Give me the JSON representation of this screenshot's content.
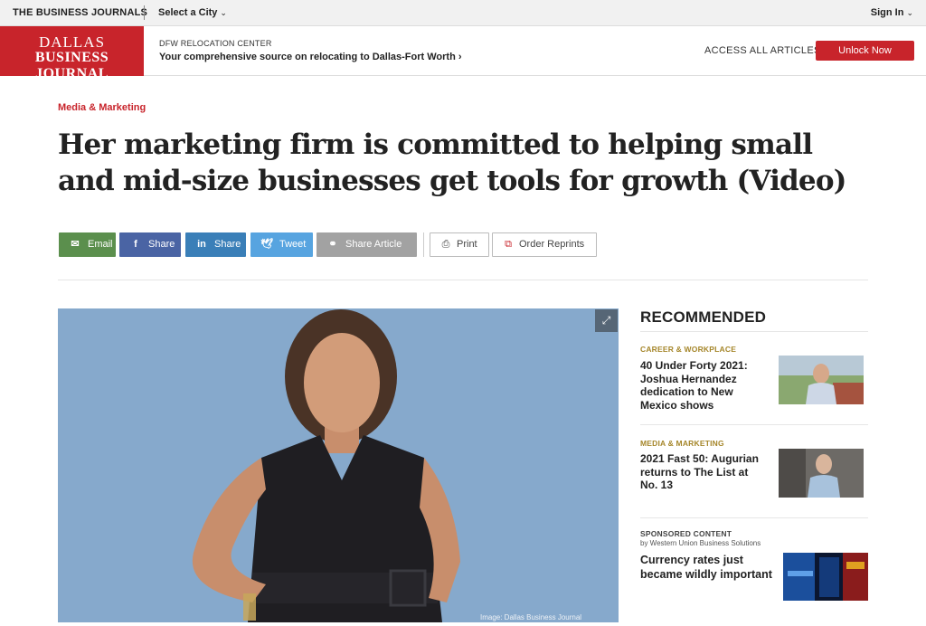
{
  "topbar": {
    "brand": "THE BUSINESS JOURNALS",
    "city_select": "Select a City",
    "sign_in": "Sign In"
  },
  "header": {
    "logo_line1": "DALLAS",
    "logo_line2": "BUSINESS JOURNAL",
    "relocation_label": "DFW RELOCATION CENTER",
    "relocation_text": "Your comprehensive source on relocating to Dallas-Fort Worth",
    "access_label": "ACCESS ALL ARTICLES",
    "unlock_label": "Unlock Now"
  },
  "article": {
    "section": "Media & Marketing",
    "headline": "Her marketing firm is committed to helping small and mid-size businesses get tools for growth (Video)",
    "image_credit": "Image: Dallas Business Journal"
  },
  "share": {
    "email": "Email",
    "facebook": "Share",
    "linkedin": "Share",
    "twitter": "Tweet",
    "share_article": "Share Article",
    "print": "Print",
    "order_reprints": "Order Reprints"
  },
  "recommended": {
    "title": "RECOMMENDED",
    "items": [
      {
        "category": "CAREER & WORKPLACE",
        "title": "40 Under Forty 2021: Joshua Hernandez dedication to New Mexico shows"
      },
      {
        "category": "MEDIA & MARKETING",
        "title": "2021 Fast 50: Augurian returns to The List at No. 13"
      }
    ],
    "sponsored": {
      "label": "SPONSORED CONTENT",
      "by": "by Western Union Business Solutions",
      "title": "Currency rates just became wildly important"
    }
  },
  "colors": {
    "brand_red": "#c8242b",
    "email_green": "#5b8f4d",
    "facebook_blue": "#4a64a4",
    "linkedin_blue": "#3a7fb8",
    "twitter_blue": "#57a4e0",
    "category_gold": "#a5862a"
  }
}
